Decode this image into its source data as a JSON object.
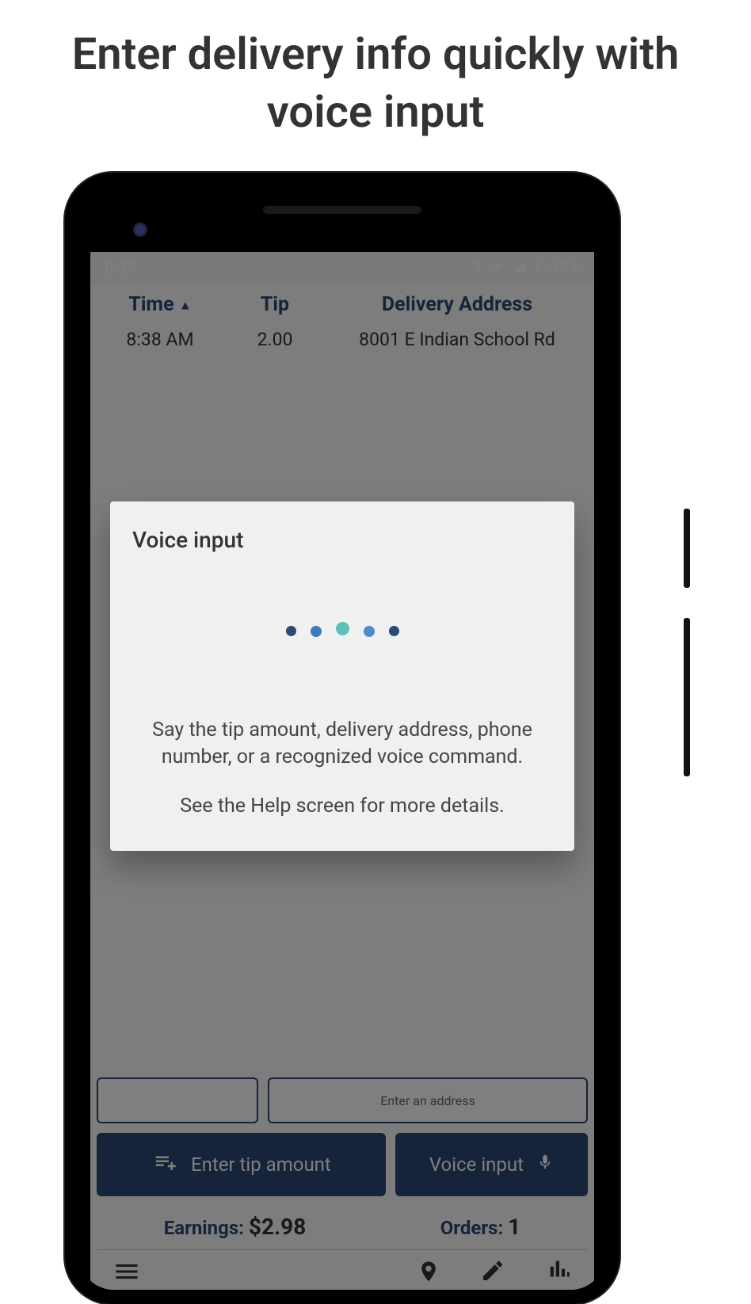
{
  "marketing_title": "Enter delivery info quickly with voice input",
  "status": {
    "time": "8:39",
    "battery": "99%"
  },
  "table": {
    "headers": {
      "time": "Time",
      "tip": "Tip",
      "address": "Delivery Address"
    },
    "rows": [
      {
        "time": "8:38 AM",
        "tip": "2.00",
        "address": "8001 E Indian School Rd"
      }
    ]
  },
  "buttons": {
    "enter_tip": "Enter tip amount",
    "voice_input": "Voice input",
    "enter_address": "Enter an address"
  },
  "stats": {
    "earnings_label": "Earnings:",
    "earnings_value": "$2.98",
    "orders_label": "Orders:",
    "orders_value": "1"
  },
  "dialog": {
    "title": "Voice input",
    "body1": "Say the tip amount, delivery address, phone number, or a recognized voice command.",
    "body2": "See the Help screen for more details."
  }
}
